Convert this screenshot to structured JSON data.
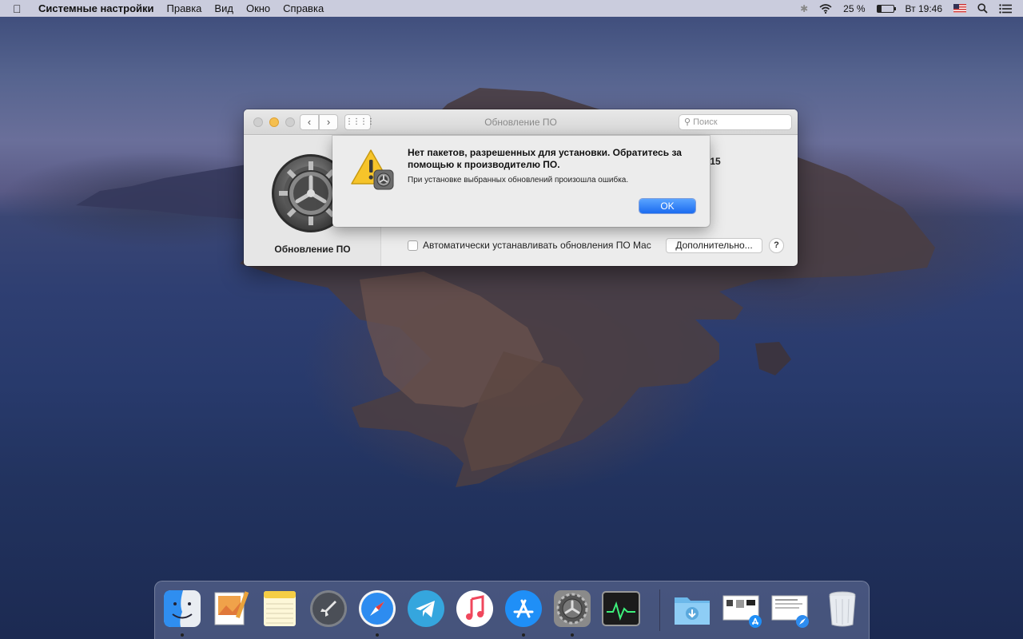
{
  "menubar": {
    "app_name": "Системные настройки",
    "menus": [
      "Правка",
      "Вид",
      "Окно",
      "Справка"
    ],
    "battery_percent": "25 %",
    "battery_level": 0.25,
    "clock": "Вт 19:46"
  },
  "window": {
    "title": "Обновление ПО",
    "search_placeholder": "Поиск",
    "pane_label": "Обновление ПО",
    "version_fragment": ".15",
    "auto_update_label": "Автоматически устанавливать обновления ПО Mac",
    "auto_update_checked": false,
    "advanced_button": "Дополнительно...",
    "help_button": "?"
  },
  "alert": {
    "title": "Нет пакетов, разрешенных для установки. Обратитесь за помощью к производителю ПО.",
    "message": "При установке выбранных обновлений произошла ошибка.",
    "ok_button": "OK"
  },
  "dock": {
    "items": [
      {
        "name": "finder-icon",
        "running": true
      },
      {
        "name": "preview-icon",
        "running": false
      },
      {
        "name": "notes-icon",
        "running": false
      },
      {
        "name": "launchpad-icon",
        "running": false
      },
      {
        "name": "safari-icon",
        "running": true
      },
      {
        "name": "telegram-icon",
        "running": false
      },
      {
        "name": "music-icon",
        "running": false
      },
      {
        "name": "app-store-icon",
        "running": true
      },
      {
        "name": "system-preferences-icon",
        "running": true
      },
      {
        "name": "activity-monitor-icon",
        "running": false
      },
      {
        "name": "downloads-folder-icon",
        "running": false
      },
      {
        "name": "screenshot-stack-1-icon",
        "running": false
      },
      {
        "name": "screenshot-stack-2-icon",
        "running": false
      },
      {
        "name": "trash-icon",
        "running": false
      }
    ]
  }
}
